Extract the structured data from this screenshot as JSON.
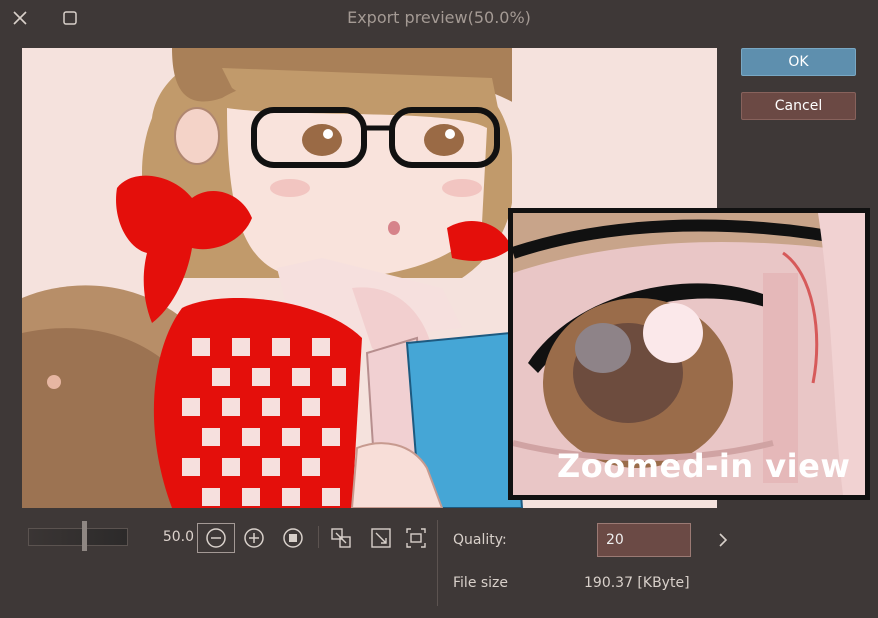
{
  "window": {
    "title": "Export preview(50.0%)",
    "close_icon": "close-icon",
    "maximize_icon": "maximize-icon"
  },
  "actions": {
    "ok_label": "OK",
    "cancel_label": "Cancel"
  },
  "zoom": {
    "value": "50.0",
    "slider_level_percent": 50
  },
  "tools": [
    {
      "icon": "zoom-out-icon"
    },
    {
      "icon": "zoom-in-icon"
    },
    {
      "icon": "actual-size-icon"
    },
    {
      "icon": "fit-width-icon"
    },
    {
      "icon": "fit-window-icon"
    },
    {
      "icon": "fit-screen-icon"
    }
  ],
  "export": {
    "quality_label": "Quality:",
    "quality_value": "20",
    "filesize_label": "File size",
    "filesize_value": "190.37 [KByte]"
  },
  "overlay": {
    "zoom_label": "Zoomed-in view"
  },
  "colors": {
    "ok": "#5e8fae",
    "cancel": "#6b4944",
    "background": "#3e3837"
  }
}
